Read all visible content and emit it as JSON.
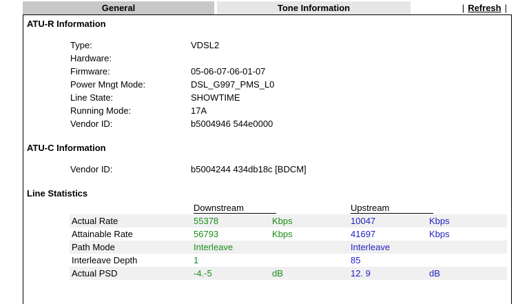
{
  "tabs": {
    "general": "General",
    "tone": "Tone Information",
    "refresh": "Refresh",
    "pipe": "|"
  },
  "atur": {
    "title": "ATU-R Information",
    "rows": [
      {
        "label": "Type:",
        "value": "VDSL2"
      },
      {
        "label": "Hardware:",
        "value": ""
      },
      {
        "label": "Firmware:",
        "value": "05-06-07-06-01-07"
      },
      {
        "label": "Power Mngt Mode:",
        "value": "DSL_G997_PMS_L0"
      },
      {
        "label": "Line State:",
        "value": "SHOWTIME"
      },
      {
        "label": "Running Mode:",
        "value": "17A"
      },
      {
        "label": "Vendor ID:",
        "value": "b5004946 544e0000"
      }
    ]
  },
  "atuc": {
    "title": "ATU-C Information",
    "rows": [
      {
        "label": "Vendor ID:",
        "value": "b5004244 434db18c [BDCM]"
      }
    ]
  },
  "stats": {
    "title": "Line Statistics",
    "downstream_header": "Downstream",
    "upstream_header": "Upstream",
    "rows": [
      {
        "label": "Actual Rate",
        "down": "55378",
        "down_unit": "Kbps",
        "up": "10047",
        "up_unit": "Kbps"
      },
      {
        "label": "Attainable Rate",
        "down": "56793",
        "down_unit": "Kbps",
        "up": "41697",
        "up_unit": "Kbps"
      },
      {
        "label": "Path Mode",
        "down": "Interleave",
        "down_unit": "",
        "up": "Interleave",
        "up_unit": ""
      },
      {
        "label": "Interleave Depth",
        "down": "1",
        "down_unit": "",
        "up": "85",
        "up_unit": ""
      },
      {
        "label": "Actual PSD",
        "down": "-4.-5",
        "down_unit": "dB",
        "up": "12. 9",
        "up_unit": "dB"
      }
    ]
  },
  "colors": {
    "downstream": "#1a8c1a",
    "upstream": "#1f1fbf",
    "active_tab": "#c8c8c8",
    "inactive_tab": "#e6e6e6",
    "row_shade": "#f0f0f0"
  }
}
